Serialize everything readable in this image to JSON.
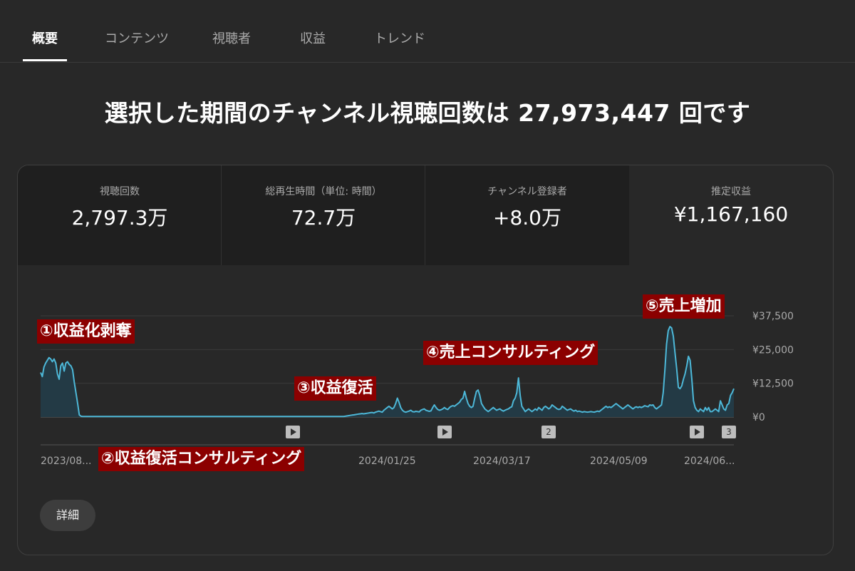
{
  "tabs": [
    {
      "label": "概要",
      "active": true
    },
    {
      "label": "コンテンツ",
      "active": false
    },
    {
      "label": "視聴者",
      "active": false
    },
    {
      "label": "収益",
      "active": false
    },
    {
      "label": "トレンド",
      "active": false
    }
  ],
  "headline": "選択した期間のチャンネル視聴回数は 27,973,447 回です",
  "metrics": [
    {
      "label": "視聴回数",
      "value": "2,797.3万"
    },
    {
      "label": "総再生時間（単位: 時間）",
      "value": "72.7万"
    },
    {
      "label": "チャンネル登録者",
      "value": "+8.0万"
    },
    {
      "label": "推定収益",
      "value": "¥1,167,160"
    }
  ],
  "annotations": [
    "①収益化剥奪",
    "②収益復活コンサルティング",
    "③収益復活",
    "④売上コンサルティング",
    "⑤売上増加"
  ],
  "markers": [
    {
      "type": "play",
      "label": ""
    },
    {
      "type": "play",
      "label": ""
    },
    {
      "type": "count",
      "label": "2"
    },
    {
      "type": "play",
      "label": ""
    },
    {
      "type": "count",
      "label": "3"
    }
  ],
  "details_label": "詳細",
  "colors": {
    "line": "#4db8d8",
    "fill": "#233a45",
    "grid": "#3a3a3a",
    "annotation_bg": "#8b0000"
  },
  "chart_data": {
    "type": "area",
    "x_tick_labels": [
      "2023/08...",
      "2024/01/25",
      "2024/03/17",
      "2024/05/09",
      "2024/06..."
    ],
    "y_tick_labels": [
      "¥37,500",
      "¥25,000",
      "¥12,500",
      "¥0"
    ],
    "ylim": [
      0,
      37500
    ],
    "series": [
      {
        "values": [
          16500,
          15000,
          18500,
          20000,
          21000,
          22000,
          21500,
          20500,
          21500,
          20000,
          16000,
          14000,
          19000,
          20000,
          17000,
          20000,
          20500,
          19500,
          19000,
          17500,
          13000,
          9000,
          5000,
          800,
          300,
          200,
          200,
          200,
          200,
          200,
          200,
          200,
          200,
          200,
          200,
          200,
          200,
          200,
          200,
          200,
          200,
          200,
          200,
          200,
          200,
          200,
          200,
          200,
          200,
          200,
          200,
          200,
          200,
          200,
          200,
          200,
          200,
          200,
          200,
          200,
          200,
          200,
          200,
          200,
          200,
          200,
          200,
          200,
          200,
          200,
          200,
          200,
          200,
          200,
          200,
          200,
          200,
          200,
          200,
          200,
          200,
          200,
          200,
          200,
          200,
          200,
          200,
          200,
          200,
          200,
          200,
          200,
          200,
          200,
          200,
          200,
          200,
          200,
          200,
          200,
          200,
          200,
          200,
          200,
          200,
          200,
          200,
          200,
          200,
          200,
          200,
          200,
          200,
          200,
          200,
          200,
          200,
          200,
          200,
          200,
          200,
          200,
          200,
          200,
          200,
          200,
          200,
          200,
          200,
          200,
          200,
          200,
          200,
          200,
          200,
          200,
          200,
          200,
          200,
          200,
          200,
          200,
          200,
          200,
          200,
          200,
          200,
          200,
          200,
          200,
          200,
          200,
          200,
          200,
          200,
          200,
          200,
          200,
          200,
          200,
          200,
          200,
          200,
          200,
          200,
          200,
          200,
          200,
          200,
          200,
          200,
          200,
          200,
          200,
          200,
          200,
          200,
          200,
          200,
          200,
          200,
          300,
          400,
          500,
          600,
          700,
          800,
          900,
          1000,
          1100,
          1200,
          1300,
          1200,
          1300,
          1400,
          1500,
          1600,
          1700,
          1500,
          1800,
          2000,
          2200,
          2000,
          1800,
          2500,
          3000,
          3500,
          4000,
          3500,
          3000,
          3500,
          5000,
          7000,
          5500,
          3500,
          2500,
          2000,
          1800,
          2000,
          2200,
          2500,
          2000,
          1900,
          2100,
          2000,
          1900,
          2500,
          2800,
          3000,
          2500,
          2300,
          2100,
          2300,
          3500,
          4500,
          3500,
          2800,
          2500,
          2700,
          3000,
          3500,
          3000,
          2800,
          3500,
          4000,
          4200,
          4000,
          4500,
          5000,
          5500,
          6500,
          7000,
          9500,
          7000,
          5000,
          4000,
          3500,
          4000,
          7000,
          9500,
          10000,
          8000,
          5000,
          4000,
          3000,
          2500,
          2000,
          2500,
          3000,
          3500,
          3000,
          2500,
          2800,
          3000,
          2500,
          2200,
          2500,
          2800,
          3000,
          3500,
          3800,
          6000,
          7000,
          9000,
          14500,
          8000,
          4000,
          3000,
          2000,
          2500,
          3000,
          2500,
          2000,
          2500,
          3000,
          2500,
          3500,
          3000,
          2500,
          3500,
          4000,
          3500,
          3000,
          3500,
          4500,
          4000,
          3500,
          3000,
          2800,
          3000,
          4000,
          3500,
          3000,
          2500,
          2800,
          3000,
          2500,
          2200,
          2500,
          2000,
          2200,
          2000,
          1800,
          2000,
          1900,
          1800,
          1900,
          2000,
          1900,
          1800,
          2000,
          2200,
          2000,
          2500,
          3000,
          3500,
          4000,
          3500,
          3800,
          3500,
          4000,
          4500,
          5000,
          4500,
          4000,
          3500,
          3000,
          3500,
          4000,
          4500,
          4000,
          3500,
          3000,
          3500,
          3800,
          3500,
          3800,
          3500,
          3800,
          4200,
          4000,
          3800,
          4500,
          4300,
          4500,
          3500,
          3000,
          3500,
          4000,
          4500,
          9000,
          17500,
          27000,
          32000,
          33500,
          33000,
          30000,
          24000,
          18000,
          11000,
          10500,
          11500,
          14000,
          16000,
          19000,
          22500,
          21000,
          14000,
          6000,
          3500,
          2500,
          2000,
          3000,
          2500,
          2000,
          3500,
          2500,
          3500,
          2000,
          2000,
          2500,
          3000,
          2500,
          2000,
          6000,
          4500,
          3000,
          2500,
          4500,
          5000,
          8000,
          9000,
          10500
        ]
      }
    ]
  }
}
